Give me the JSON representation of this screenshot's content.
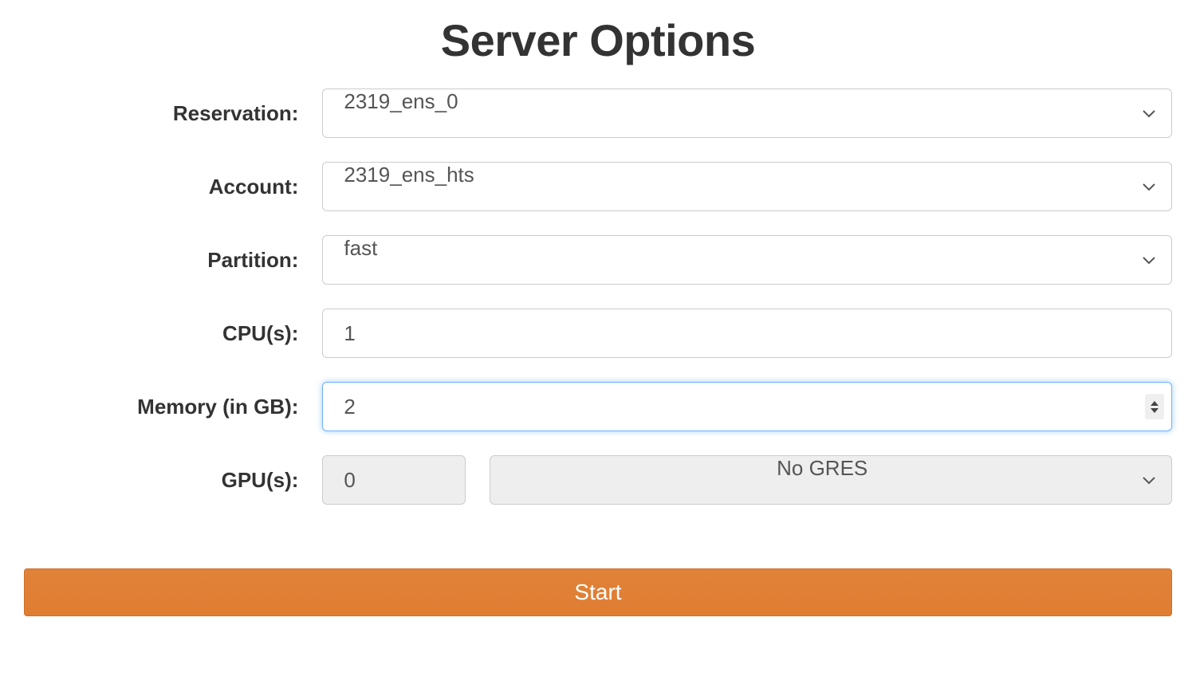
{
  "title": "Server Options",
  "fields": {
    "reservation": {
      "label": "Reservation:",
      "value": "2319_ens_0"
    },
    "account": {
      "label": "Account:",
      "value": "2319_ens_hts"
    },
    "partition": {
      "label": "Partition:",
      "value": "fast"
    },
    "cpus": {
      "label": "CPU(s):",
      "value": "1"
    },
    "memory": {
      "label": "Memory (in GB):",
      "value": "2"
    },
    "gpus": {
      "label": "GPU(s):",
      "count": "0",
      "gres": "No GRES"
    }
  },
  "actions": {
    "start": "Start"
  }
}
